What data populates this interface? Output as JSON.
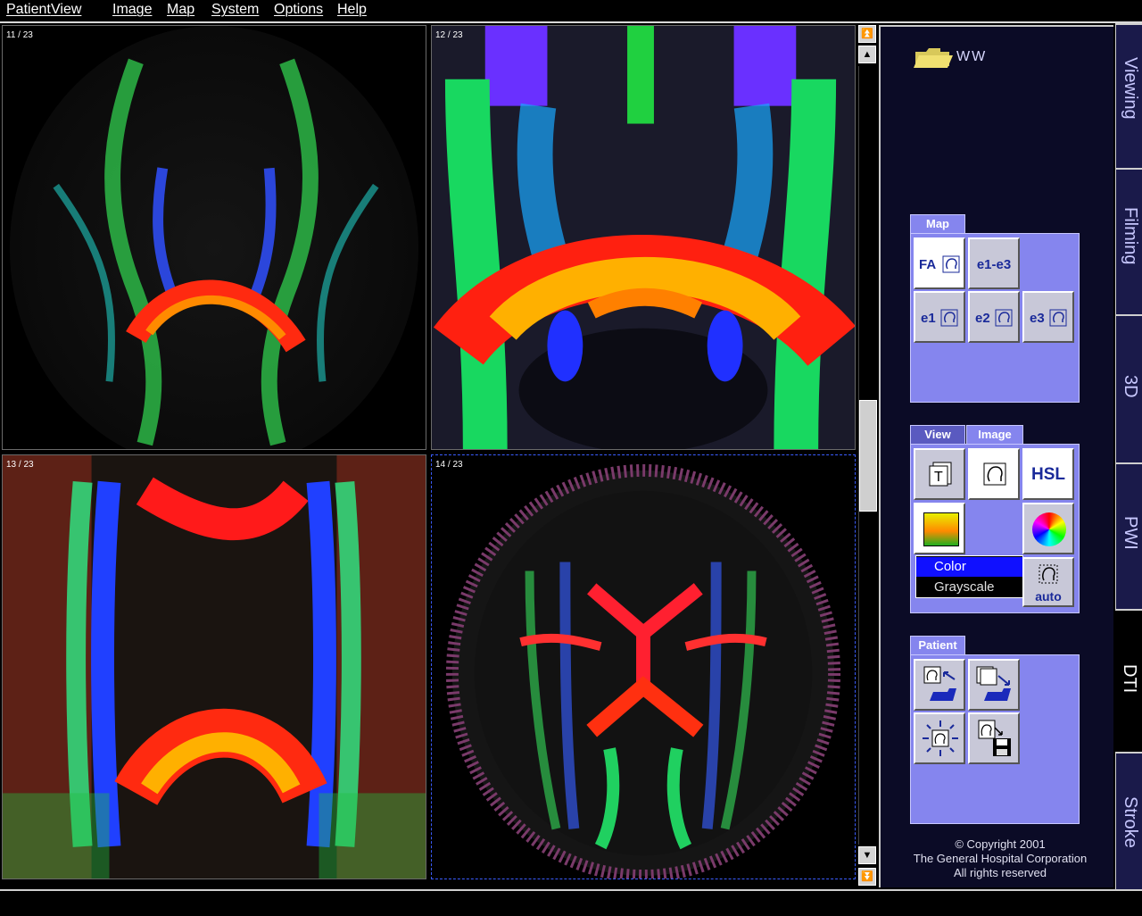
{
  "menu": [
    "Patient",
    "View",
    "Image",
    "Map",
    "System",
    "Options",
    "Help"
  ],
  "panes": [
    {
      "label": "11 / 23"
    },
    {
      "label": "12 / 23"
    },
    {
      "label": "13 / 23"
    },
    {
      "label": "14 / 23"
    }
  ],
  "folder": {
    "label": "WW",
    "icon": "folder-icon"
  },
  "side_tabs": [
    "Viewing",
    "Filming",
    "3D",
    "PWI",
    "DTI",
    "Stroke"
  ],
  "active_tab": "DTI",
  "map_group": {
    "tab": "Map",
    "buttons": [
      "FA",
      "e1-e3",
      "e1",
      "e2",
      "e3"
    ]
  },
  "view_group": {
    "tabs": [
      "View",
      "Image"
    ],
    "active": "Image",
    "hsl_label": "HSL",
    "auto_label": "auto",
    "dropdown": {
      "selected": "Color",
      "options": [
        "Color",
        "Grayscale"
      ]
    }
  },
  "patient_group": {
    "tab": "Patient"
  },
  "copyright": [
    "© Copyright 2001",
    "The General Hospital Corporation",
    "All rights reserved"
  ],
  "colors": {
    "panel_bg": "#0b0b26",
    "group_bg": "#8585ee",
    "button_text": "#1a2a9a",
    "selected": "#1010ff"
  }
}
